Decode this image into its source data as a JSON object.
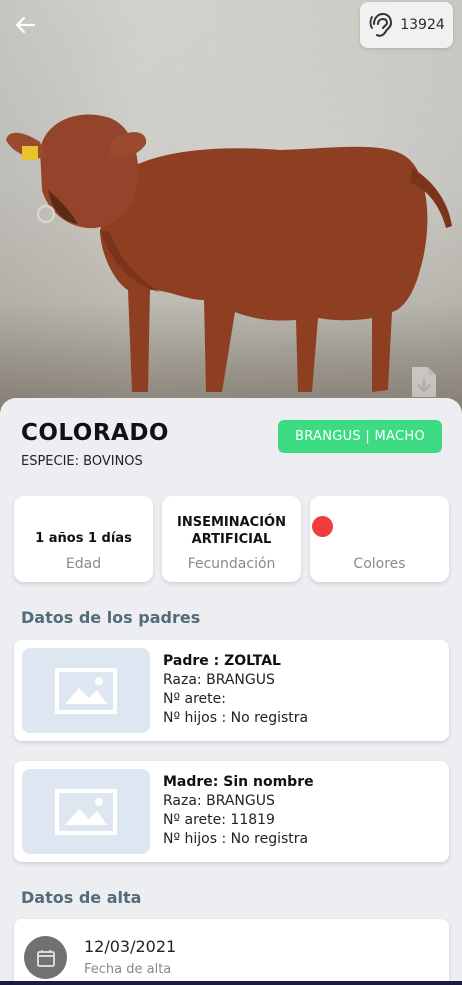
{
  "header": {
    "tag_number": "13924"
  },
  "animal": {
    "name": "COLORADO",
    "species": "ESPECIE: BOVINOS",
    "badge": "BRANGUS | MACHO"
  },
  "stats": [
    {
      "value": "1 años  1 días",
      "label": "Edad"
    },
    {
      "value": "INSEMINACIÓN ARTIFICIAL",
      "label": "Fecundación"
    },
    {
      "value": "",
      "label": "Colores",
      "color": "#f03c3c"
    }
  ],
  "parents_section_title": "Datos de los padres",
  "parents": [
    {
      "name": "Padre : ZOLTAL",
      "breed": "Raza: BRANGUS",
      "tag": "Nº arete:",
      "children": "Nº hijos : No registra"
    },
    {
      "name": "Madre: Sin nombre",
      "breed": "Raza: BRANGUS",
      "tag": "Nº arete: 11819",
      "children": "Nº hijos : No registra"
    }
  ],
  "alta_section_title": "Datos de alta",
  "alta": {
    "date": "12/03/2021",
    "label": "Fecha de alta"
  },
  "colors": {
    "badge": "#3ddc84",
    "section_title": "#546b7a",
    "color_dot": "#f03c3c"
  }
}
